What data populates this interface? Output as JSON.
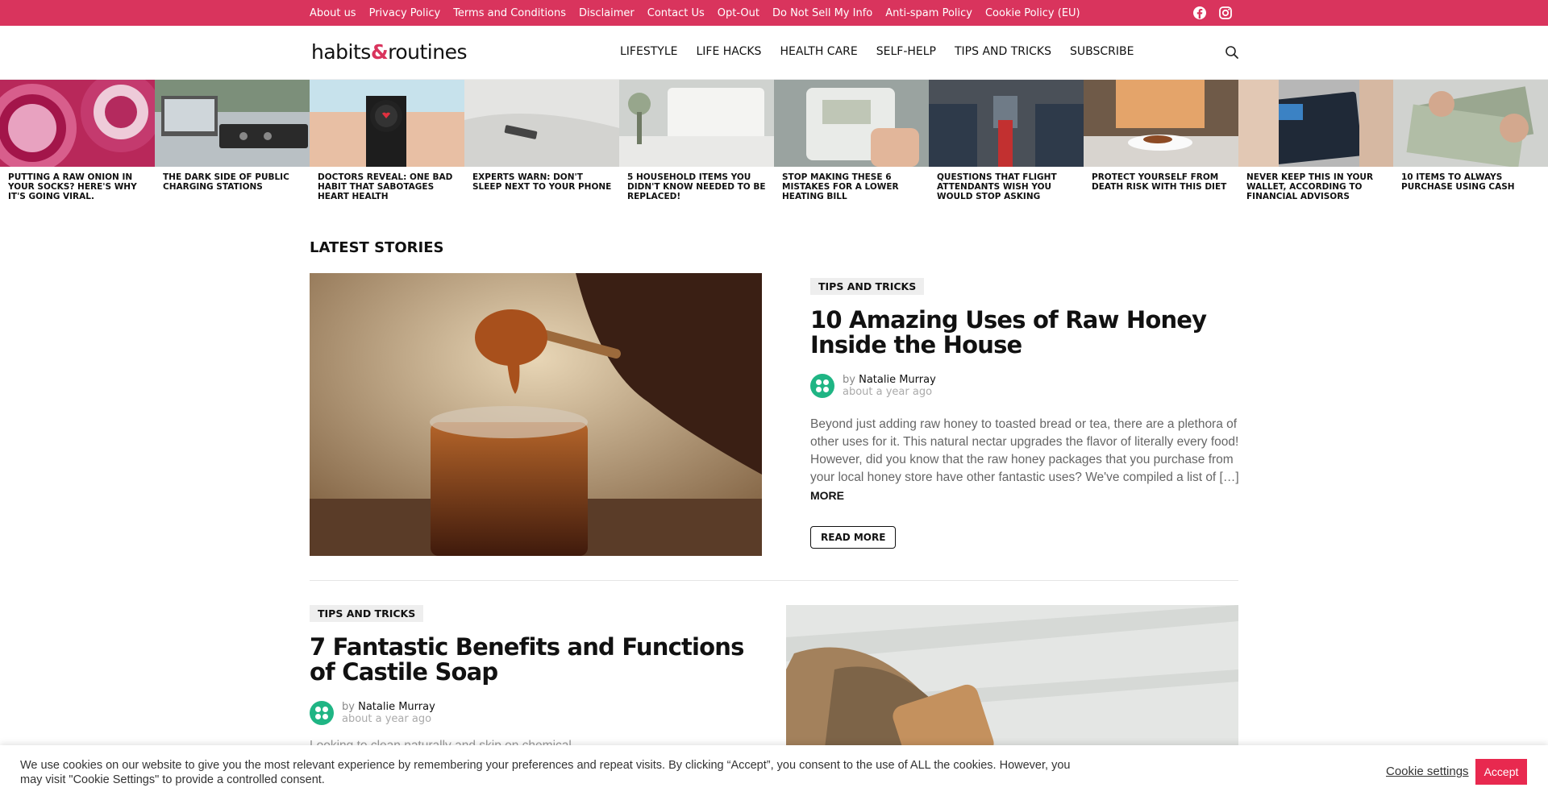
{
  "topbar": {
    "links": [
      "About us",
      "Privacy Policy",
      "Terms and Conditions",
      "Disclaimer",
      "Contact Us",
      "Opt-Out",
      "Do Not Sell My Info",
      "Anti-spam Policy",
      "Cookie Policy (EU)"
    ],
    "social": [
      "facebook-icon",
      "instagram-icon"
    ],
    "color": "#d9345d"
  },
  "header": {
    "logo_left": "habits",
    "logo_amp": "&",
    "logo_right": "routines",
    "nav": [
      "LIFESTYLE",
      "LIFE HACKS",
      "HEALTH CARE",
      "SELF-HELP",
      "TIPS AND TRICKS",
      "SUBSCRIBE"
    ]
  },
  "strip": [
    "PUTTING A RAW ONION IN YOUR SOCKS? HERE'S WHY IT'S GOING VIRAL.",
    "THE DARK SIDE OF PUBLIC CHARGING STATIONS",
    "DOCTORS REVEAL: ONE BAD HABIT THAT SABOTAGES HEART HEALTH",
    "EXPERTS WARN: DON'T SLEEP NEXT TO YOUR PHONE",
    "5 HOUSEHOLD ITEMS YOU DIDN'T KNOW NEEDED TO BE REPLACED!",
    "STOP MAKING THESE 6 MISTAKES FOR A LOWER HEATING BILL",
    "QUESTIONS THAT FLIGHT ATTENDANTS WISH YOU WOULD STOP ASKING",
    "PROTECT YOURSELF FROM DEATH RISK WITH THIS DIET",
    "NEVER KEEP THIS IN YOUR WALLET, ACCORDING TO FINANCIAL ADVISORS",
    "10 ITEMS TO ALWAYS PURCHASE USING CASH"
  ],
  "latest": {
    "title": "LATEST STORIES",
    "post1": {
      "category": "TIPS AND TRICKS",
      "title": "10 Amazing Uses of Raw Honey Inside the House",
      "by": "by",
      "author": "Natalie Murray",
      "date": "about a year ago",
      "excerpt": "Beyond just adding raw honey to toasted bread or tea, there are a plethora of other uses for it. This natural nectar upgrades the flavor of literally every food!  However, did you know that the raw honey packages that you purchase from your local honey store have other fantastic uses?  We've compiled a list of […]",
      "more": "MORE",
      "read_more": "READ MORE"
    },
    "post2": {
      "category": "TIPS AND TRICKS",
      "title": "7 Fantastic Benefits and Functions of Castile Soap",
      "by": "by",
      "author": "Natalie Murray",
      "date": "about a year ago",
      "excerpt_partial": "Looking to clean naturally and skip on chemical..."
    }
  },
  "cookie": {
    "message": "We use cookies on our website to give you the most relevant experience by remembering your preferences and repeat visits. By clicking “Accept”, you consent to the use of ALL the cookies. However, you may visit \"Cookie Settings\" to provide a controlled consent.",
    "settings": "Cookie settings",
    "accept": "Accept"
  }
}
